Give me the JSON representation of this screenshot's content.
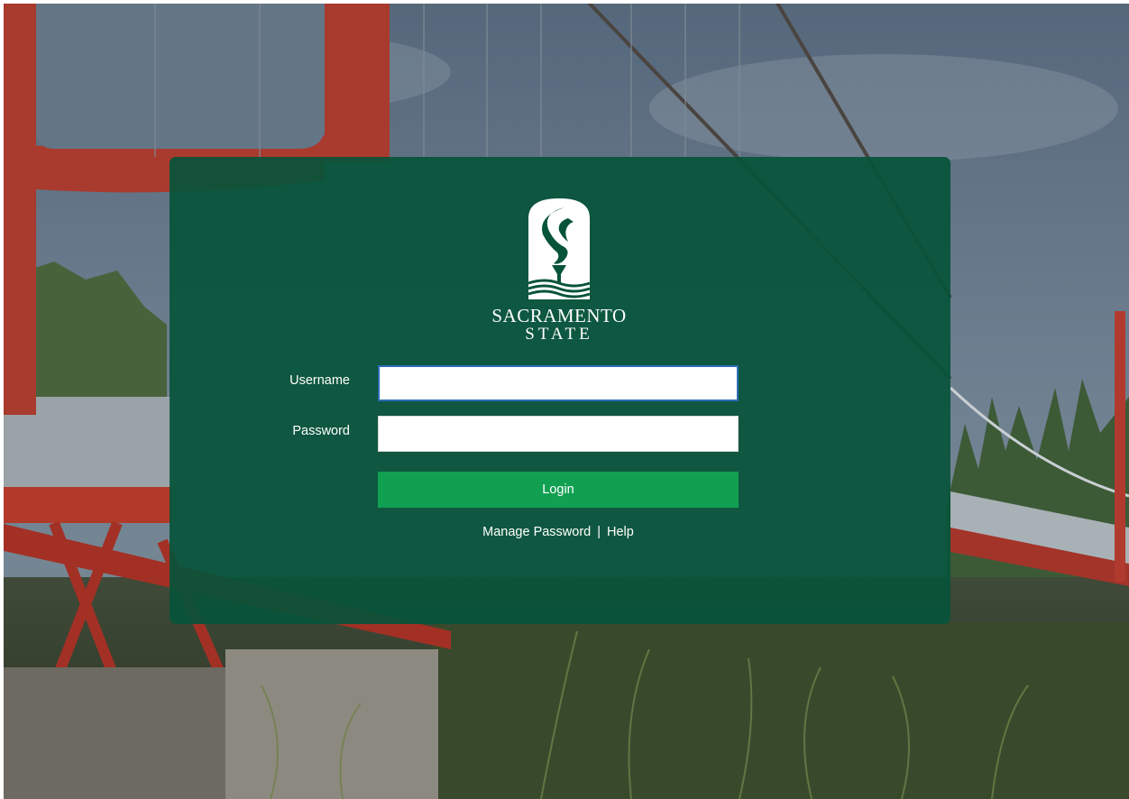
{
  "background": {
    "scene": "red suspension bridge over river with trees and grass"
  },
  "logo": {
    "icon": "torch-s-shield-icon",
    "line1": "SACRAMENTO",
    "line2": "STATE"
  },
  "form": {
    "username_label": "Username",
    "username_value": "",
    "password_label": "Password",
    "password_value": "",
    "login_label": "Login"
  },
  "links": {
    "manage_password": "Manage Password",
    "separator": "|",
    "help": "Help"
  },
  "colors": {
    "panel": "#06543A",
    "button": "#11A052",
    "focus_border": "#2A6DB5"
  }
}
